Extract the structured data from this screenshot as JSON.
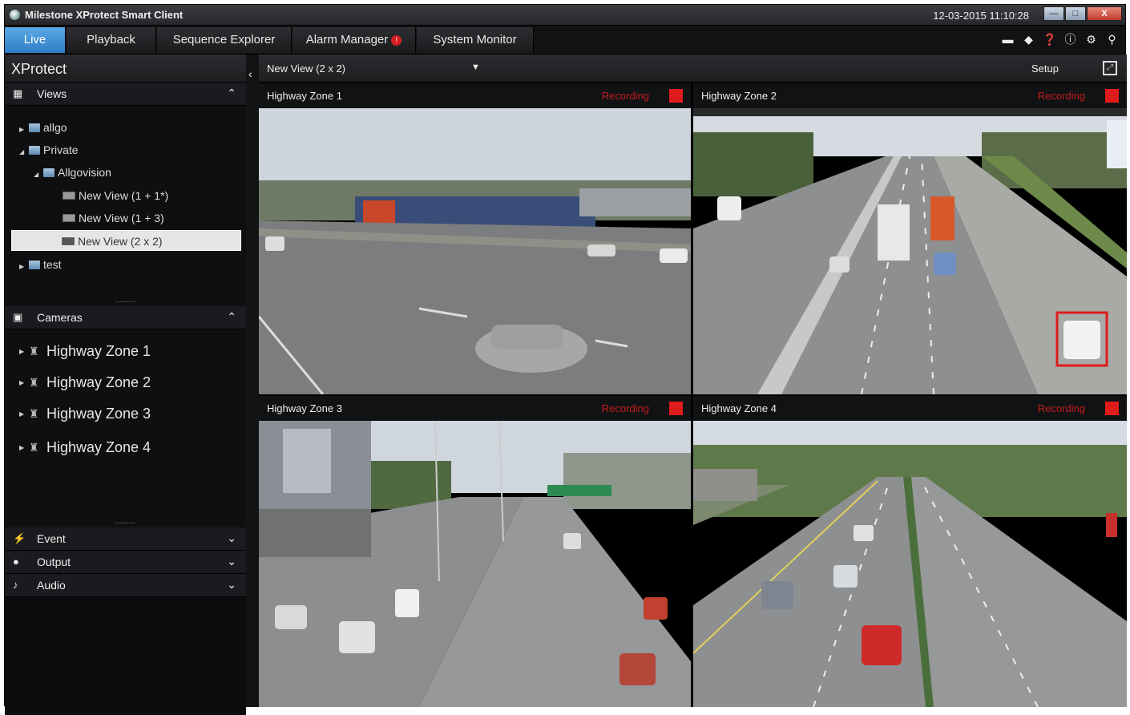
{
  "app": {
    "title": "Milestone XProtect Smart Client",
    "datetime": "12-03-2015 11:10:28"
  },
  "window_buttons": {
    "minimize": "—",
    "maximize": "□",
    "close": "X"
  },
  "tabs": [
    {
      "label": "Live",
      "active": true
    },
    {
      "label": "Playback"
    },
    {
      "label": "Sequence Explorer"
    },
    {
      "label": "Alarm Manager",
      "badge": "!"
    },
    {
      "label": "System Monitor"
    }
  ],
  "toolbar_icons": [
    "disconnect-icon",
    "navigate-icon",
    "help-icon",
    "info-icon",
    "settings-icon",
    "key-icon"
  ],
  "left_panel": {
    "title": "XProtect",
    "views": {
      "label": "Views",
      "tree": [
        {
          "label": "allgo",
          "level": 0,
          "expanded": false,
          "kind": "folder"
        },
        {
          "label": "Private",
          "level": 0,
          "expanded": true,
          "kind": "folder"
        },
        {
          "label": "Allgovision",
          "level": 1,
          "expanded": true,
          "kind": "folder"
        },
        {
          "label": "New View (1 + 1*)",
          "level": 2,
          "kind": "view"
        },
        {
          "label": "New View (1 + 3)",
          "level": 2,
          "kind": "view"
        },
        {
          "label": "New View (2 x 2)",
          "level": 2,
          "kind": "view",
          "selected": true
        },
        {
          "label": "test",
          "level": 0,
          "expanded": false,
          "kind": "folder"
        }
      ]
    },
    "cameras": {
      "label": "Cameras",
      "items": [
        "Highway Zone 1",
        "Highway Zone 2",
        "Highway Zone 3",
        "Highway Zone 4"
      ]
    },
    "event": {
      "label": "Event"
    },
    "output": {
      "label": "Output"
    },
    "audio": {
      "label": "Audio"
    },
    "splitter": "........."
  },
  "viewbar": {
    "view_name": "New View (2 x 2)",
    "setup_label": "Setup"
  },
  "tiles": [
    {
      "camera": "Highway Zone 1",
      "status": "Recording"
    },
    {
      "camera": "Highway Zone 2",
      "status": "Recording"
    },
    {
      "camera": "Highway Zone 3",
      "status": "Recording"
    },
    {
      "camera": "Highway Zone 4",
      "status": "Recording"
    }
  ],
  "colors": {
    "active_tab": "#3a8ad3",
    "recording": "#e01b1b",
    "detection_box": "#e01b1b",
    "panel_bg": "#121315"
  }
}
